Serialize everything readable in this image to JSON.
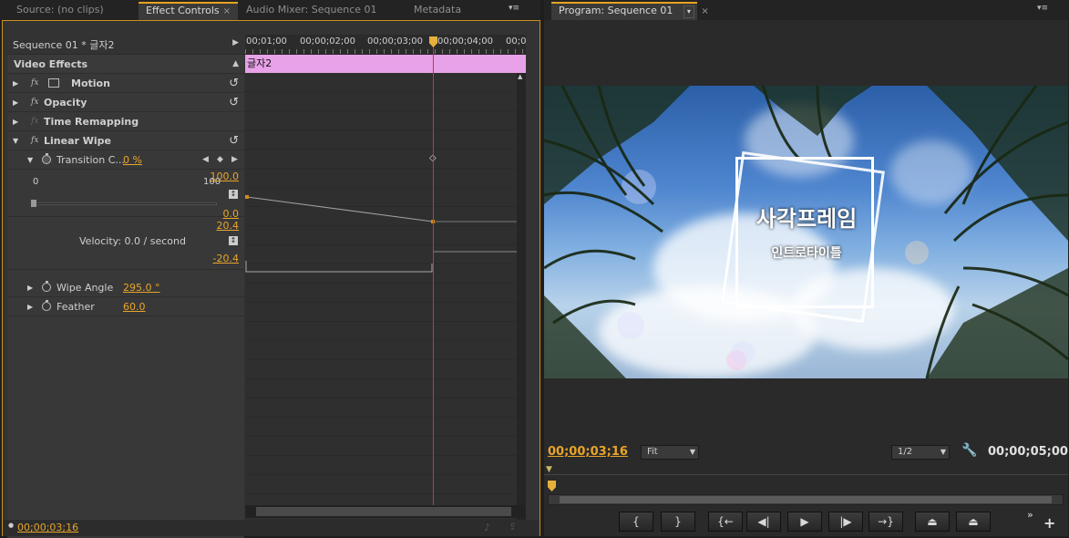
{
  "left_tabs": [
    {
      "label": "Source: (no clips)",
      "active": false
    },
    {
      "label": "Effect Controls",
      "active": true
    },
    {
      "label": "Audio Mixer: Sequence 01",
      "active": false
    },
    {
      "label": "Metadata",
      "active": false
    }
  ],
  "right_tabs": [
    {
      "label": "Program: Sequence 01",
      "active": true
    }
  ],
  "effect_controls": {
    "sequence_clip": "Sequence 01 * 글자2",
    "section_title": "Video Effects",
    "clip_bar_label": "글자2",
    "ruler_labels": [
      "00;01;00",
      "00;00;02;00",
      "00;00;03;00",
      "00;00;04;00",
      "00;0"
    ],
    "effects": [
      {
        "name": "Motion"
      },
      {
        "name": "Opacity"
      },
      {
        "name": "Time Remapping"
      },
      {
        "name": "Linear Wipe"
      }
    ],
    "transition": {
      "label": "Transition C...",
      "value": "0 %"
    },
    "graph": {
      "value_max": "100.0",
      "slider_min": "0",
      "slider_max": "100",
      "value_min": "0.0",
      "velocity_max": "20.4",
      "velocity_label": "Velocity: 0.0 / second",
      "velocity_min": "-20.4"
    },
    "wipe_angle": {
      "label": "Wipe Angle",
      "value": "295.0 °"
    },
    "feather": {
      "label": "Feather",
      "value": "60.0"
    },
    "current_time": "00;00;03;16"
  },
  "program_monitor": {
    "overlay_title": "사각프레임",
    "overlay_subtitle": "인트로타이틀",
    "current_time": "00;00;03;16",
    "fit_label": "Fit",
    "resolution_label": "1/2",
    "duration": "00;00;05;00",
    "transport_buttons": [
      {
        "name": "mark-in-button",
        "glyph": "{"
      },
      {
        "name": "mark-out-button",
        "glyph": "}"
      },
      {
        "name": "go-to-in-button",
        "glyph": "{←"
      },
      {
        "name": "step-back-button",
        "glyph": "◀|"
      },
      {
        "name": "play-button",
        "glyph": "▶"
      },
      {
        "name": "step-forward-button",
        "glyph": "|▶"
      },
      {
        "name": "go-to-out-button",
        "glyph": "→}"
      },
      {
        "name": "lift-button",
        "glyph": "⏏"
      },
      {
        "name": "extract-button",
        "glyph": "⏏"
      }
    ]
  },
  "colors": {
    "accent": "#e8a52a",
    "clip_bar": "#e8a2e8",
    "playhead": "#e0301e"
  }
}
